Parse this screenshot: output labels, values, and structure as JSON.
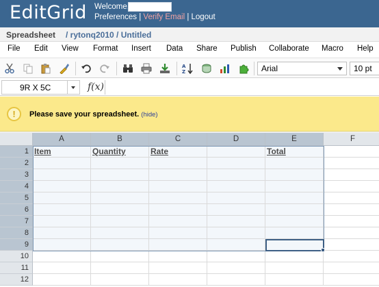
{
  "header": {
    "logo": "EditGrid",
    "welcome": "Welcome,",
    "links": {
      "preferences": "Preferences",
      "sep1": " | ",
      "verify_email": "Verify Email",
      "sep2": " | ",
      "logout": "Logout"
    }
  },
  "breadcrumb": {
    "section": "Spreadsheet",
    "path": "/ rytonq2010 / Untitled"
  },
  "menu": [
    "File",
    "Edit",
    "View",
    "Format",
    "Insert",
    "Data",
    "Share",
    "Publish",
    "Collaborate",
    "Macro",
    "Help"
  ],
  "toolbar": {
    "icons": [
      "cut-icon",
      "copy-icon",
      "paste-icon",
      "format-painter-icon",
      "undo-icon",
      "redo-icon",
      "find-icon",
      "print-icon",
      "download-icon",
      "sort-icon",
      "chart-icon",
      "insert-chart-icon",
      "plugin-icon"
    ],
    "font": "Arial",
    "font_size": "10 pt"
  },
  "formula_bar": {
    "name_box": "9R X 5C",
    "fx": "f(x)"
  },
  "notice": {
    "icon": "!",
    "message": "Please save your spreadsheet.",
    "hide": "(hide)"
  },
  "grid": {
    "columns": [
      "A",
      "B",
      "C",
      "D",
      "E",
      "F"
    ],
    "rows": [
      "1",
      "2",
      "3",
      "4",
      "5",
      "6",
      "7",
      "8",
      "9",
      "10",
      "11",
      "12"
    ],
    "cells": {
      "A1": "Item",
      "B1": "Quantity",
      "C1": "Rate",
      "E1": "Total"
    },
    "selection": "A1:E9",
    "active_cell": "E9"
  },
  "colors": {
    "header_bg": "#3b6690",
    "notice_bg": "#fbe98b",
    "selection_border": "#3d5f85",
    "link_red": "#f4a3a3"
  }
}
